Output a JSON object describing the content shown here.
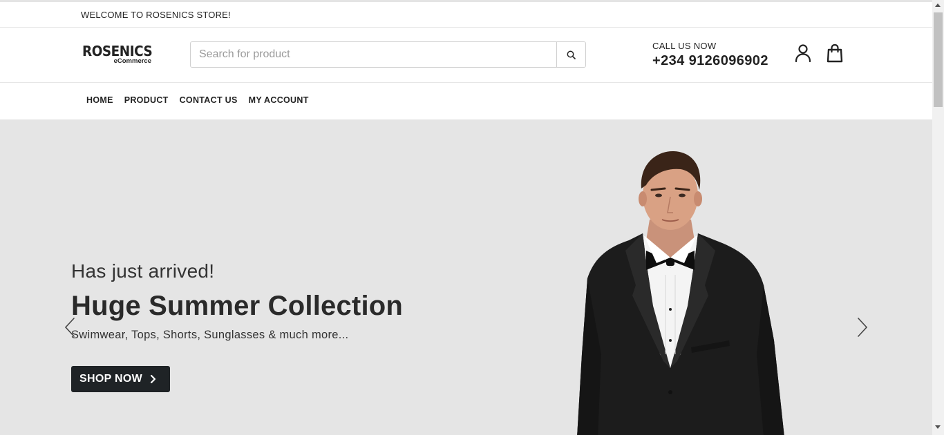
{
  "topbar": {
    "welcome_text": "WELCOME TO ROSENICS STORE!"
  },
  "header": {
    "logo_main": "ROSENICS",
    "logo_sub": "eCommerce",
    "search_placeholder": "Search for product",
    "call_label": "CALL US NOW",
    "call_number": "+234 9126096902"
  },
  "nav": {
    "items": [
      {
        "label": "HOME"
      },
      {
        "label": "PRODUCT"
      },
      {
        "label": "CONTACT US"
      },
      {
        "label": "MY ACCOUNT"
      }
    ]
  },
  "hero": {
    "subtitle": "Has just arrived!",
    "title": "Huge Summer Collection",
    "description": "Swimwear, Tops, Shorts, Sunglasses & much more...",
    "button_label": "SHOP NOW",
    "background_color": "#e5e5e5",
    "button_color": "#1f2326"
  },
  "icons": {
    "search": "search-icon",
    "user": "user-icon",
    "cart": "shopping-bag-icon",
    "prev": "chevron-left-icon",
    "next": "chevron-right-icon"
  }
}
